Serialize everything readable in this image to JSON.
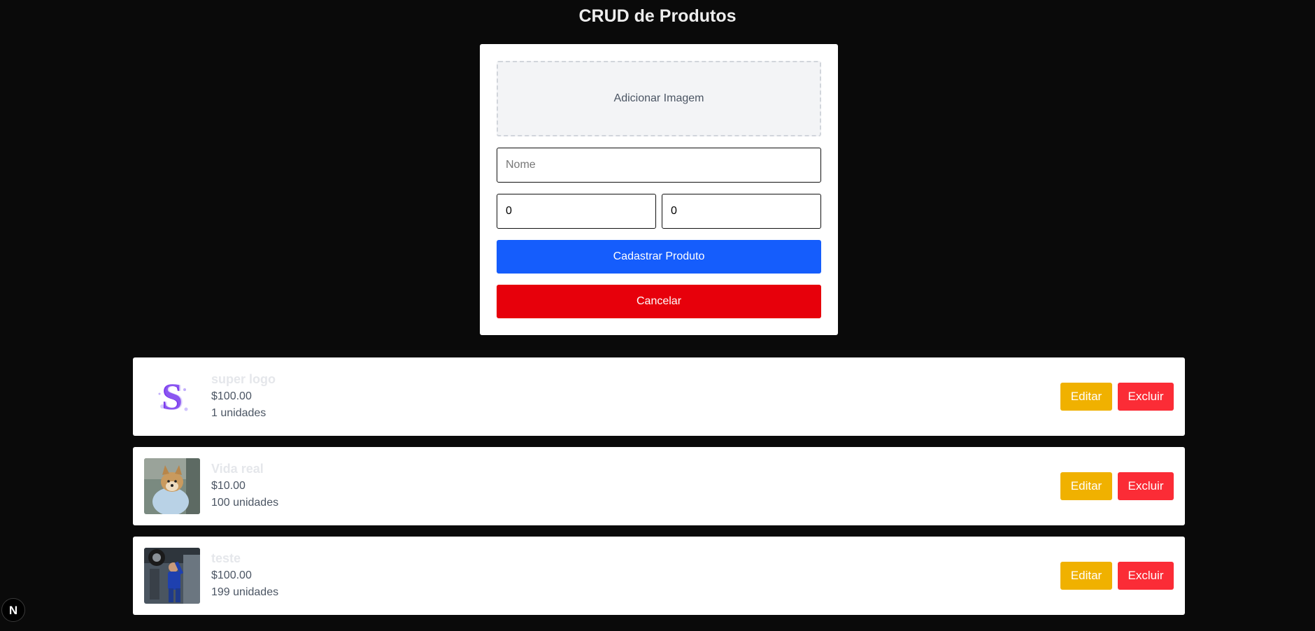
{
  "header": {
    "title": "CRUD de Produtos"
  },
  "form": {
    "image_label": "Adicionar Imagem",
    "name_placeholder": "Nome",
    "name_value": "",
    "price_value": "0",
    "quantity_value": "0",
    "submit_label": "Cadastrar Produto",
    "cancel_label": "Cancelar"
  },
  "products": [
    {
      "name": "super logo",
      "price": "$100.00",
      "quantity": "1 unidades",
      "edit_label": "Editar",
      "delete_label": "Excluir"
    },
    {
      "name": "Vida real",
      "price": "$10.00",
      "quantity": "100 unidades",
      "edit_label": "Editar",
      "delete_label": "Excluir"
    },
    {
      "name": "teste",
      "price": "$100.00",
      "quantity": "199 unidades",
      "edit_label": "Editar",
      "delete_label": "Excluir"
    }
  ],
  "colors": {
    "background": "#0a0a0a",
    "primary": "#155dfc",
    "danger": "#e7000b",
    "edit": "#f0b100",
    "delete": "#fb2c36"
  },
  "devtools": {
    "icon": "nextjs-icon",
    "letter": "N"
  }
}
